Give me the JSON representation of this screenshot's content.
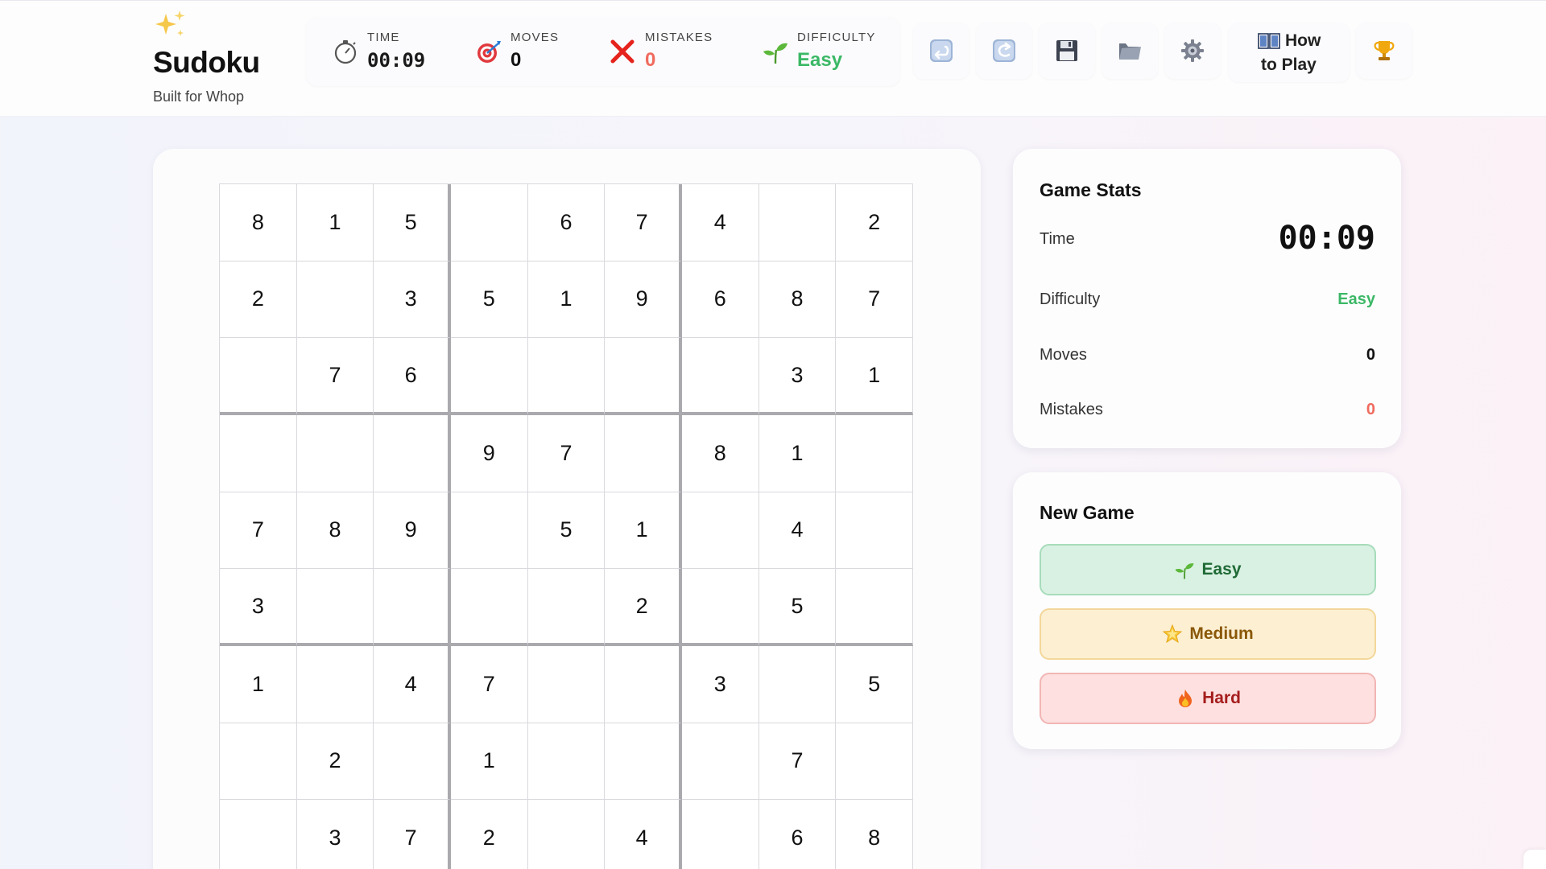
{
  "brand": {
    "title": "Sudoku",
    "subtitle": "Built for Whop"
  },
  "header_stats": {
    "time": {
      "label": "TIME",
      "value": "00:09"
    },
    "moves": {
      "label": "MOVES",
      "value": "0"
    },
    "mistakes": {
      "label": "MISTAKES",
      "value": "0"
    },
    "difficulty": {
      "label": "DIFFICULTY",
      "value": "Easy"
    }
  },
  "toolbar": {
    "undo_icon": "undo-arrow-icon",
    "redo_icon": "redo-arrow-icon",
    "save_icon": "floppy-disk-icon",
    "load_icon": "folder-icon",
    "settings_icon": "gear-icon",
    "how_to_play_line1": "How",
    "how_to_play_line2": "to Play",
    "leaderboard_icon": "trophy-icon"
  },
  "board": {
    "rows": [
      [
        "8",
        "1",
        "5",
        "",
        "6",
        "7",
        "4",
        "",
        "2"
      ],
      [
        "2",
        "",
        "3",
        "5",
        "1",
        "9",
        "6",
        "8",
        "7"
      ],
      [
        "",
        "7",
        "6",
        "",
        "",
        "",
        "",
        "3",
        "1"
      ],
      [
        "",
        "",
        "",
        "9",
        "7",
        "",
        "8",
        "1",
        ""
      ],
      [
        "7",
        "8",
        "9",
        "",
        "5",
        "1",
        "",
        "4",
        ""
      ],
      [
        "3",
        "",
        "",
        "",
        "",
        "2",
        "",
        "5",
        ""
      ],
      [
        "1",
        "",
        "4",
        "7",
        "",
        "",
        "3",
        "",
        "5"
      ],
      [
        "",
        "2",
        "",
        "1",
        "",
        "",
        "",
        "7",
        ""
      ],
      [
        "",
        "3",
        "7",
        "2",
        "",
        "4",
        "",
        "6",
        "8"
      ]
    ]
  },
  "game_stats": {
    "title": "Game Stats",
    "time_label": "Time",
    "time_value": "00:09",
    "difficulty_label": "Difficulty",
    "difficulty_value": "Easy",
    "moves_label": "Moves",
    "moves_value": "0",
    "mistakes_label": "Mistakes",
    "mistakes_value": "0"
  },
  "new_game": {
    "title": "New Game",
    "easy_label": "Easy",
    "medium_label": "Medium",
    "hard_label": "Hard"
  },
  "colors": {
    "easy_green": "#3bb866",
    "mistake_red": "#f06b5e",
    "grid_thick": "#a9a9ae",
    "grid_thin": "#d9d9de"
  }
}
